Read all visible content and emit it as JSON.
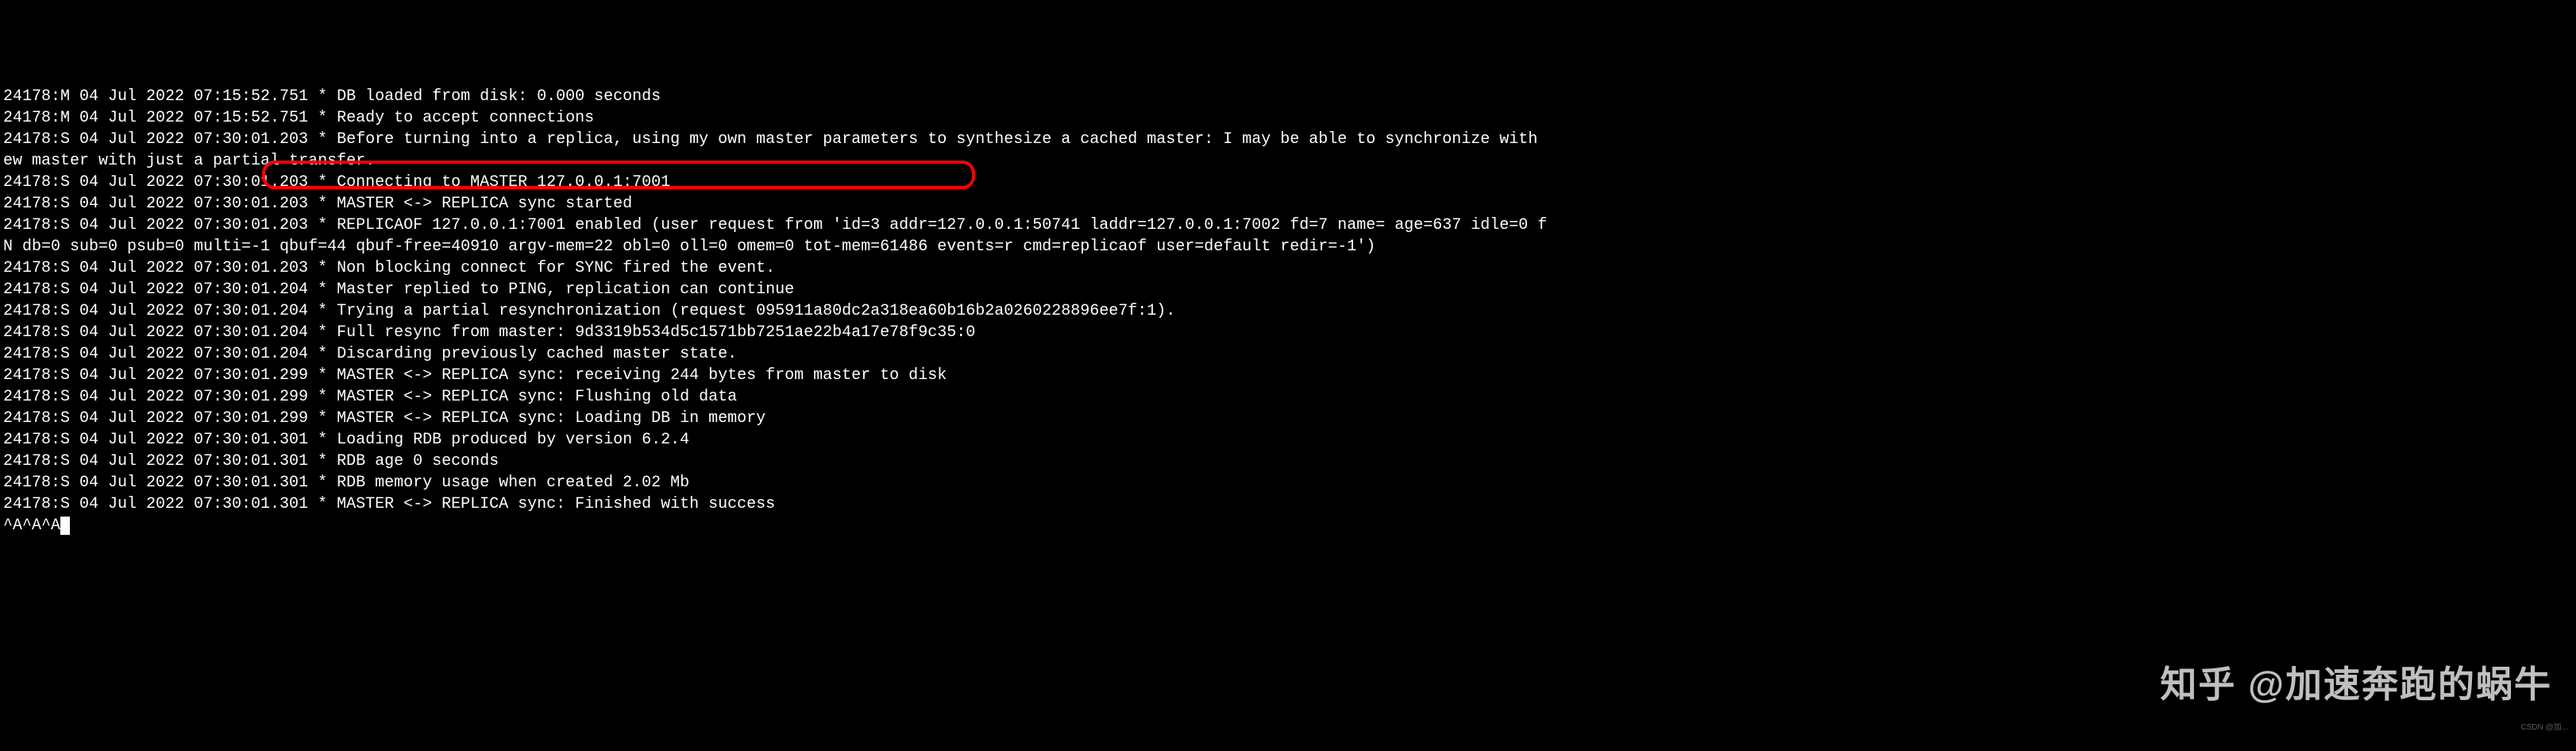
{
  "logs": [
    "24178:M 04 Jul 2022 07:15:52.751 * DB loaded from disk: 0.000 seconds",
    "24178:M 04 Jul 2022 07:15:52.751 * Ready to accept connections",
    "24178:S 04 Jul 2022 07:30:01.203 * Before turning into a replica, using my own master parameters to synthesize a cached master: I may be able to synchronize with",
    "ew master with just a partial transfer.",
    "24178:S 04 Jul 2022 07:30:01.203 * Connecting to MASTER 127.0.0.1:7001",
    "24178:S 04 Jul 2022 07:30:01.203 * MASTER <-> REPLICA sync started",
    "24178:S 04 Jul 2022 07:30:01.203 * REPLICAOF 127.0.0.1:7001 enabled (user request from 'id=3 addr=127.0.0.1:50741 laddr=127.0.0.1:7002 fd=7 name= age=637 idle=0 f",
    "N db=0 sub=0 psub=0 multi=-1 qbuf=44 qbuf-free=40910 argv-mem=22 obl=0 oll=0 omem=0 tot-mem=61486 events=r cmd=replicaof user=default redir=-1')",
    "24178:S 04 Jul 2022 07:30:01.203 * Non blocking connect for SYNC fired the event.",
    "24178:S 04 Jul 2022 07:30:01.204 * Master replied to PING, replication can continue",
    "24178:S 04 Jul 2022 07:30:01.204 * Trying a partial resynchronization (request 095911a80dc2a318ea60b16b2a0260228896ee7f:1).",
    "24178:S 04 Jul 2022 07:30:01.204 * Full resync from master: 9d3319b534d5c1571bb7251ae22b4a17e78f9c35:0",
    "24178:S 04 Jul 2022 07:30:01.204 * Discarding previously cached master state.",
    "24178:S 04 Jul 2022 07:30:01.299 * MASTER <-> REPLICA sync: receiving 244 bytes from master to disk",
    "24178:S 04 Jul 2022 07:30:01.299 * MASTER <-> REPLICA sync: Flushing old data",
    "24178:S 04 Jul 2022 07:30:01.299 * MASTER <-> REPLICA sync: Loading DB in memory",
    "24178:S 04 Jul 2022 07:30:01.301 * Loading RDB produced by version 6.2.4",
    "24178:S 04 Jul 2022 07:30:01.301 * RDB age 0 seconds",
    "24178:S 04 Jul 2022 07:30:01.301 * RDB memory usage when created 2.02 Mb",
    "24178:S 04 Jul 2022 07:30:01.301 * MASTER <-> REPLICA sync: Finished with success"
  ],
  "prompt_line": "^A^A^A",
  "cursor_char": " ",
  "highlight": {
    "line_index": 10
  },
  "watermark": {
    "main": "知乎 @加速奔跑的蜗牛",
    "sub": "CSDN @加..."
  }
}
